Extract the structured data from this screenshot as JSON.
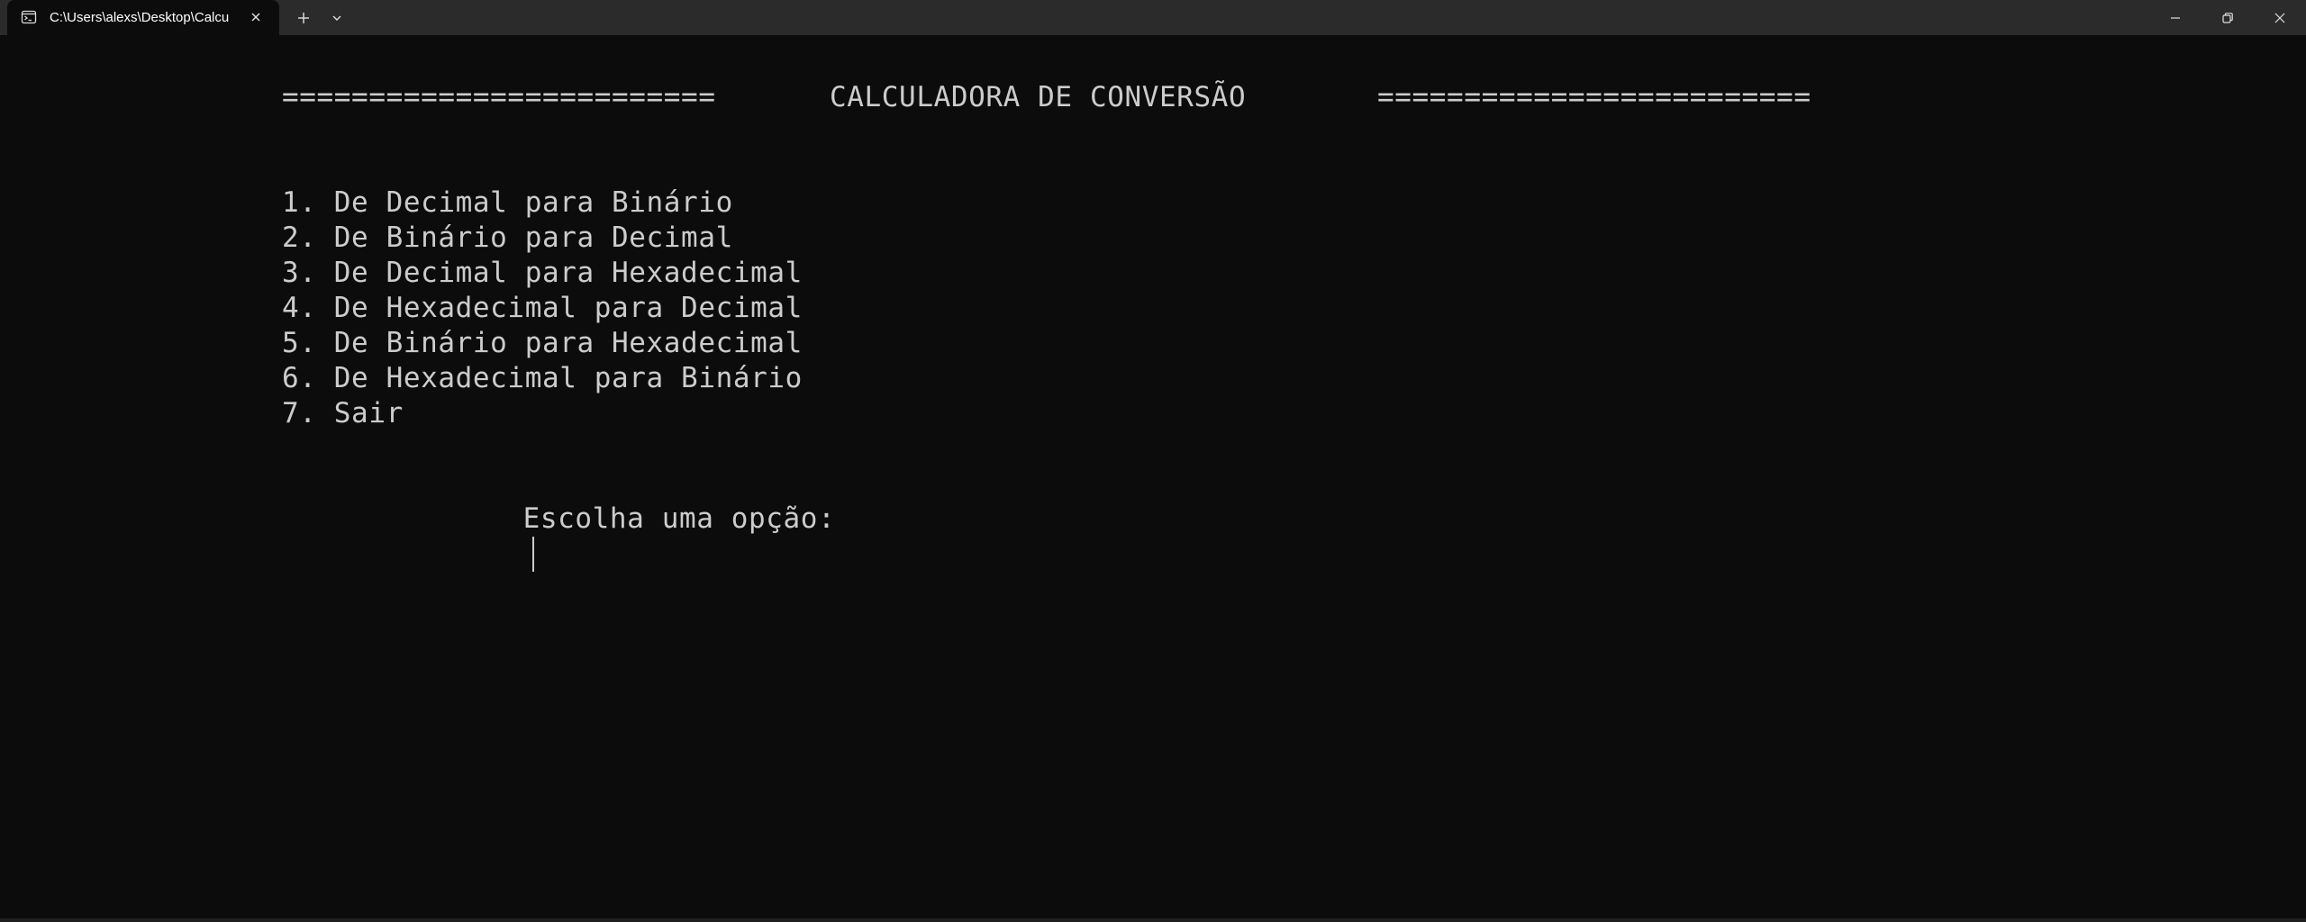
{
  "titlebar": {
    "tab_title": "C:\\Users\\alexs\\Desktop\\Calcu",
    "tab_icon": "terminal-icon",
    "close_icon": "close-icon",
    "new_tab_icon": "plus-icon",
    "dropdown_icon": "chevron-down-icon",
    "window_controls": [
      "minimize-icon",
      "restore-icon",
      "close-icon"
    ]
  },
  "console": {
    "header": {
      "left_rule": "=========================",
      "title": "CALCULADORA DE CONVERSÃO",
      "right_rule": "========================="
    },
    "menu": [
      "1. De Decimal para Binário",
      "2. De Binário para Decimal",
      "3. De Decimal para Hexadecimal",
      "4. De Hexadecimal para Decimal",
      "5. De Binário para Hexadecimal",
      "6. De Hexadecimal para Binário",
      "7. Sair"
    ],
    "prompt": "Escolha uma opção:",
    "input_value": ""
  },
  "colors": {
    "titlebar_bg": "#2b2b2b",
    "console_bg": "#0c0c0c",
    "console_text": "#cccccc",
    "tab_text": "#ffffff"
  }
}
